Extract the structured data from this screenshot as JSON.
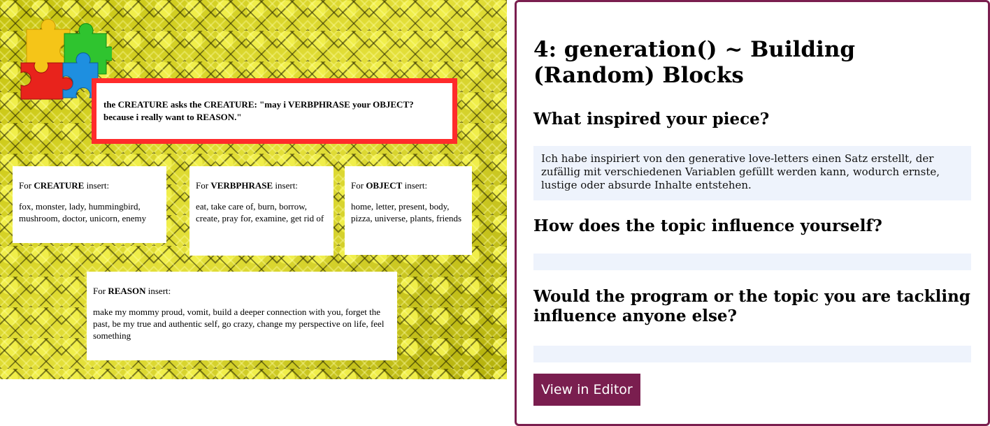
{
  "sketch": {
    "main_sentence": "the CREATURE asks the CREATURE: \"may i VERBPHRASE your OBJECT? because i really want to REASON.\"",
    "boxes": {
      "creature": {
        "prefix": "For ",
        "variable": "CREATURE",
        "suffix": " insert:",
        "values": "fox, monster, lady, hummingbird, mushroom, doctor, unicorn, enemy"
      },
      "verbphrase": {
        "prefix": "For ",
        "variable": "VERBPHRASE",
        "suffix": " insert:",
        "values": "eat, take care of, burn, borrow, create, pray for, examine, get rid of"
      },
      "object": {
        "prefix": "For ",
        "variable": "OBJECT",
        "suffix": " insert:",
        "values": "home, letter, present, body, pizza, universe, plants, friends"
      },
      "reason": {
        "prefix": "For ",
        "variable": "REASON",
        "suffix": " insert:",
        "values": "make my mommy proud, vomit, build a deeper connection with you, forget the past, be my true and authentic self, go crazy, change my perspective on life, feel something"
      }
    },
    "puzzle_colors": [
      "#f5c518",
      "#2fc42f",
      "#e8231c",
      "#1e8fe0"
    ]
  },
  "panel": {
    "title": "4: generation() ~ Building (Random) Blocks",
    "q1": "What inspired your piece?",
    "a1": "Ich habe inspiriert von den generative love-letters einen Satz erstellt, der zufällig mit verschiedenen Variablen gefüllt werden kann, wodurch ernste, lustige oder absurde Inhalte entstehen.",
    "q2": "How does the topic influence yourself?",
    "a2": "",
    "q3": "Would the program or the topic you are tackling influence anyone else?",
    "a3": "",
    "button_label": "View in Editor",
    "accent_color": "#7a1e4f",
    "answer_bg": "#eef3fc"
  }
}
